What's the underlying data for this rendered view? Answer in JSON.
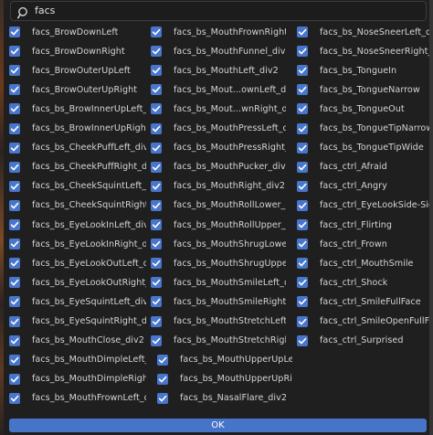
{
  "search": {
    "value": "facs",
    "icon": "search-icon"
  },
  "ok_label": "OK",
  "accent": "#4674c8",
  "columns": [
    [
      "facs_BrowDownLeft",
      "facs_BrowDownRight",
      "facs_BrowOuterUpLeft",
      "facs_BrowOuterUpRight",
      "facs_bs_BrowInnerUpLeft_...",
      "facs_bs_BrowInnerUpRight_...",
      "facs_bs_CheekPuffLeft_div2",
      "facs_bs_CheekPuffRight_div2",
      "facs_bs_CheekSquintLeft_d...",
      "facs_bs_CheekSquintRight_...",
      "facs_bs_EyeLookInLeft_div2",
      "facs_bs_EyeLookInRight_di...",
      "facs_bs_EyeLookOutLeft_di...",
      "facs_bs_EyeLookOutRight_...",
      "facs_bs_EyeSquintLeft_div2",
      "facs_bs_EyeSquintRight_div2",
      "facs_bs_MouthClose_div2",
      "facs_bs_MouthDimpleLeft_div",
      "facs_bs_MouthDimpleRight_d...",
      "facs_bs_MouthFrownLeft_div2"
    ],
    [
      "facs_bs_MouthFrownRight_...",
      "facs_bs_MouthFunnel_div2",
      "facs_bs_MouthLeft_div2",
      "facs_bs_Mout...ownLeft_div2",
      "facs_bs_Mout...wnRight_div2",
      "facs_bs_MouthPressLeft_div2",
      "facs_bs_MouthPressRight_di...",
      "facs_bs_MouthPucker_div2",
      "facs_bs_MouthRight_div2",
      "facs_bs_MouthRollLower_di...",
      "facs_bs_MouthRollUpper_di...",
      "facs_bs_MouthShrugLower_...",
      "facs_bs_MouthShrugUpper_...",
      "facs_bs_MouthSmileLeft_di...",
      "facs_bs_MouthSmileRight_...",
      "facs_bs_MouthStretchLeft_...",
      "facs_bs_MouthStretchRight...",
      "facs_bs_MouthUpperUpLeft_...",
      "facs_bs_MouthUpperUpRight...",
      "facs_bs_NasalFlare_div2"
    ],
    [
      "facs_bs_NoseSneerLeft_div2",
      "facs_bs_NoseSneerRight_di...",
      "facs_bs_TongueIn",
      "facs_bs_TongueNarrow",
      "facs_bs_TongueOut",
      "facs_bs_TongueTipNarrow",
      "facs_bs_TongueTipWide",
      "facs_ctrl_Afraid",
      "facs_ctrl_Angry",
      "facs_ctrl_EyeLookSide-Side...",
      "facs_ctrl_Flirting",
      "facs_ctrl_Frown",
      "facs_ctrl_MouthSmile",
      "facs_ctrl_Shock",
      "facs_ctrl_SmileFullFace",
      "facs_ctrl_SmileOpenFullFac",
      "facs_ctrl_Surprised"
    ]
  ]
}
